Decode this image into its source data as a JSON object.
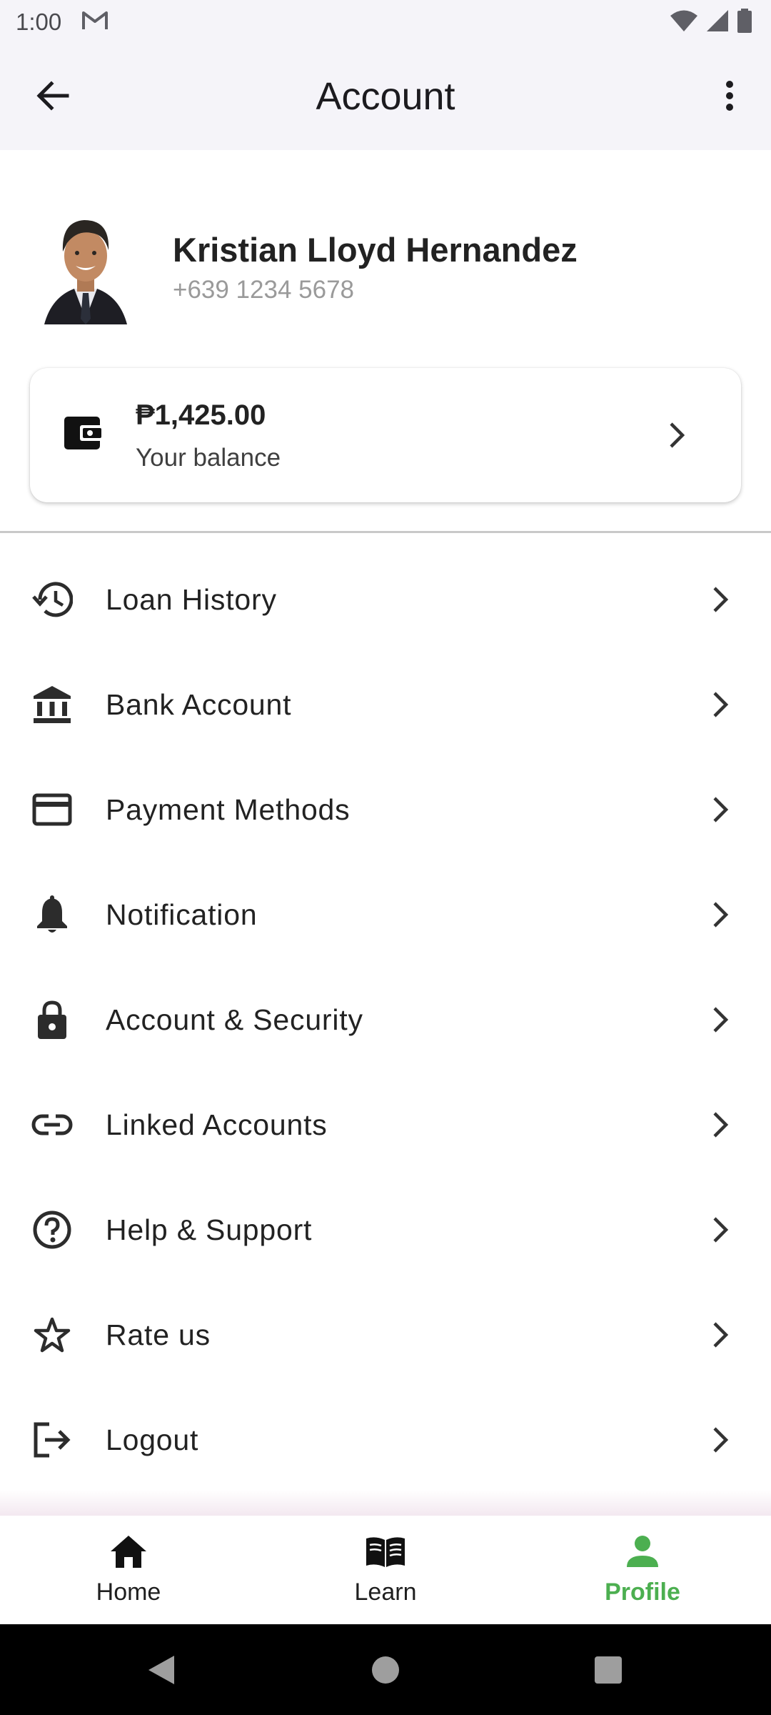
{
  "status_bar": {
    "time": "1:00",
    "notification_icon": "gmail-icon",
    "icons": [
      "wifi-icon",
      "signal-icon",
      "battery-icon"
    ]
  },
  "app_bar": {
    "title": "Account",
    "back_icon": "arrow-back-icon",
    "more_icon": "more-vert-icon"
  },
  "profile": {
    "name": "Kristian Lloyd Hernandez",
    "phone": "+639 1234 5678"
  },
  "balance": {
    "amount": "₱1,425.00",
    "label": "Your balance",
    "icon": "wallet-icon"
  },
  "menu": {
    "items": [
      {
        "label": "Loan History",
        "icon": "history-icon"
      },
      {
        "label": "Bank Account",
        "icon": "bank-icon"
      },
      {
        "label": "Payment Methods",
        "icon": "credit-card-icon"
      },
      {
        "label": "Notification",
        "icon": "bell-icon"
      },
      {
        "label": "Account & Security",
        "icon": "lock-icon"
      },
      {
        "label": "Linked Accounts",
        "icon": "link-icon"
      },
      {
        "label": "Help & Support",
        "icon": "help-icon"
      },
      {
        "label": "Rate us",
        "icon": "star-icon"
      },
      {
        "label": "Logout",
        "icon": "logout-icon"
      }
    ]
  },
  "bottom_nav": {
    "items": [
      {
        "label": "Home",
        "icon": "home-icon",
        "active": false
      },
      {
        "label": "Learn",
        "icon": "book-icon",
        "active": false
      },
      {
        "label": "Profile",
        "icon": "person-icon",
        "active": true
      }
    ]
  },
  "colors": {
    "accent": "#4caf50",
    "app_bar_bg": "#f5f4f9",
    "text_primary": "#222222",
    "text_secondary": "#9a9a9a"
  }
}
